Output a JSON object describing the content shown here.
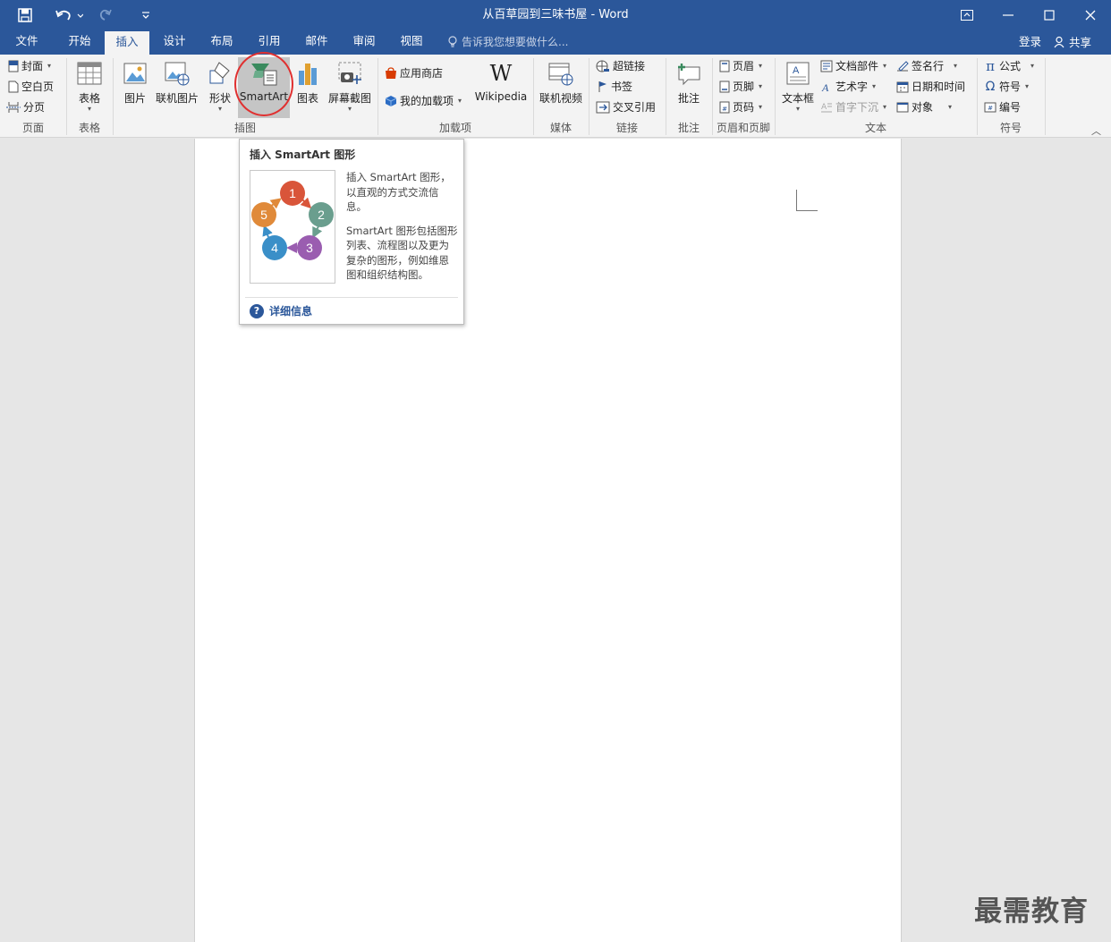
{
  "window": {
    "title": "从百草园到三味书屋 - Word"
  },
  "tabs": [
    "文件",
    "开始",
    "插入",
    "设计",
    "布局",
    "引用",
    "邮件",
    "审阅",
    "视图"
  ],
  "active_tab": "插入",
  "tellme": {
    "placeholder": "告诉我您想要做什么..."
  },
  "account": {
    "login": "登录",
    "share": "共享"
  },
  "ribbon": {
    "pages": {
      "cover": "封面",
      "blank": "空白页",
      "break": "分页",
      "group": "页面"
    },
    "tables": {
      "table": "表格",
      "group": "表格"
    },
    "illustrations": {
      "picture": "图片",
      "online_picture": "联机图片",
      "shapes": "形状",
      "smartart": "SmartArt",
      "chart": "图表",
      "screenshot": "屏幕截图",
      "group": "插图"
    },
    "addins": {
      "store": "应用商店",
      "my_addins": "我的加载项",
      "wikipedia": "Wikipedia",
      "group": "加载项"
    },
    "media": {
      "online_video": "联机视频",
      "group": "媒体"
    },
    "links": {
      "hyperlink": "超链接",
      "bookmark": "书签",
      "cross_ref": "交叉引用",
      "group": "链接"
    },
    "comments": {
      "comment": "批注",
      "group": "批注"
    },
    "header_footer": {
      "header": "页眉",
      "footer": "页脚",
      "page_number": "页码",
      "group": "页眉和页脚"
    },
    "text": {
      "textbox": "文本框",
      "quick_parts": "文档部件",
      "wordart": "艺术字",
      "dropcap": "首字下沉",
      "signature": "签名行",
      "datetime": "日期和时间",
      "object": "对象",
      "group": "文本"
    },
    "symbols": {
      "equation": "公式",
      "symbol": "符号",
      "number": "编号",
      "group": "符号"
    }
  },
  "tooltip": {
    "title": "插入 SmartArt 图形",
    "desc1": "插入 SmartArt 图形，以直观的方式交流信息。",
    "desc2": "SmartArt 图形包括图形列表、流程图以及更为复杂的图形，例如维恩图和组织结构图。",
    "link": "详细信息",
    "cycle_numbers": [
      "1",
      "2",
      "3",
      "4",
      "5"
    ]
  },
  "watermark": "最需教育",
  "colors": {
    "accent": "#2b579a",
    "highlight_circle": "#e03030",
    "cycle": [
      "#d9553a",
      "#6a9e8e",
      "#9a5db0",
      "#3a8fc8",
      "#e08a3a"
    ]
  }
}
